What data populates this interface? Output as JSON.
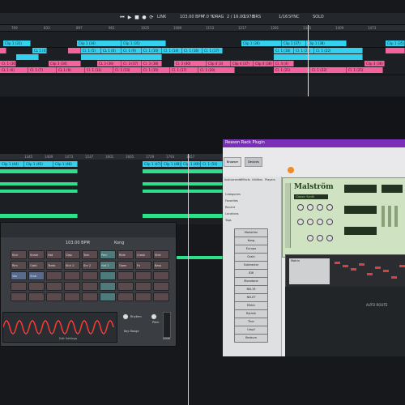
{
  "transport": {
    "tempo": "103.00 BPM",
    "swing": "7.0 %",
    "position": "2 / 16.00",
    "loop": "1978",
    "loop_unit": "BRS",
    "snap": "1/16",
    "sync": "SYNC",
    "mode": "LINK",
    "beat": "DRAG",
    "mono": "SOLO"
  },
  "ruler_top": {
    "marks": [
      "769",
      "833",
      "897",
      "961",
      "1025",
      "1089",
      "1153",
      "1217",
      "1281",
      "1345",
      "1409",
      "1473",
      "1537",
      "1601",
      "1665",
      "1729",
      "1793",
      "1857",
      "1921",
      "1985",
      "2049",
      "2113"
    ]
  },
  "ruler_mid": {
    "marks": [
      "1345",
      "1409",
      "1473",
      "1537",
      "1601",
      "1665",
      "1729",
      "1793",
      "1857",
      "1921",
      "1985"
    ]
  },
  "clips_top": {
    "row1": [
      "Clip 1 (31)",
      "Clip 1 (34)",
      "Clip 1 (35)",
      "Clip 1 (36)",
      "Clip 1 (37)",
      "Clip 1 (38)",
      "Clip 1 (35)"
    ],
    "row2": [
      "CL 1 (4)",
      "Cl. 1 (5)",
      "CL 1 (6)",
      "Cl. 1 (9)",
      "Cl. 1 (10)",
      "Cl. 1 (14)",
      "Cl. 1 (16)",
      "Cl. 1 (17)",
      "Cl. 1 (18)",
      "Cl. 1 (21)",
      "Cl. 1 (22)"
    ],
    "row3": [
      "Cl. 1 (30)",
      "Clip 3 (34)",
      "CL 3 (36)",
      "Cl. 3 (37)",
      "Cl. 3 (38)",
      "Cl. 3 (40)",
      "Clip 4 (3)",
      "Clip 4 (37)",
      "Clip 4 (38)",
      "Cl. 4 (4)",
      "Clip 3 (36)"
    ],
    "row4": [
      "CL 1 (6)",
      "Cl. 1 (7)",
      "CL 1 (9)",
      "Cl. 1 (11)",
      "Cl. 1 (13)",
      "Cl. 1 (15)",
      "Cl. 1 (17)",
      "Cl. 1 (20)",
      "Cl. 1 (21)",
      "Cl. 1 (22)",
      "Cl. 1 (25)"
    ]
  },
  "clips_mid": {
    "row1": [
      "Clip 1 (44)",
      "Clip 1 (45)",
      "Clip 1 (46)",
      "Clip 1 (47)",
      "Clip 1 (48)",
      "Clip 1 (49)",
      "Cl. 1 (50)",
      "Clip 1 (51)"
    ]
  },
  "kong": {
    "name": "Kong",
    "tempo": "103.00 BPM",
    "labels": [
      "Key Range",
      "Rhythm",
      "Pitch",
      "Level",
      "Edit Settings"
    ],
    "pads": [
      "Kick",
      "Snare",
      "Hat",
      "Clap",
      "Tom",
      "Perc",
      "Ride",
      "Crash",
      "Shkr",
      "Rim",
      "Cwbl",
      "Tamb",
      "Kick 2",
      "Snr 2",
      "Hat 2",
      "Open",
      "Fx",
      "Bass",
      "Vox",
      "Stab"
    ]
  },
  "rack": {
    "title": "Reason Rack Plugin",
    "tab_browser": "Browser",
    "tab_devices": "Devices",
    "filters": [
      "Instruments",
      "Effects",
      "Utilities",
      "Players"
    ],
    "sidebar_sections": [
      "Categories",
      "Favorites",
      "Recent",
      "Locations",
      "Tags"
    ],
    "device_items": [
      "Malström",
      "Kong",
      "Europa",
      "Grain",
      "Subtractor",
      "ID8",
      "Monotone",
      "NN-19",
      "NN-XT",
      "Mimic",
      "Rytmik",
      "Thor",
      "Umpf",
      "Redrum"
    ],
    "malstrom_logo": "Malström",
    "malstrom_patch": "Classic Synth",
    "sequencer_label": "Matrix",
    "auto_route": "AUTO ROUTE"
  },
  "colors": {
    "accent_cyan": "#35d0ee",
    "accent_pink": "#f4639d",
    "accent_green": "#2ee08a",
    "rack_title": "#7a2fb8",
    "malstrom_bg": "#cfe3c3",
    "waveform": "#ff3b3b"
  }
}
